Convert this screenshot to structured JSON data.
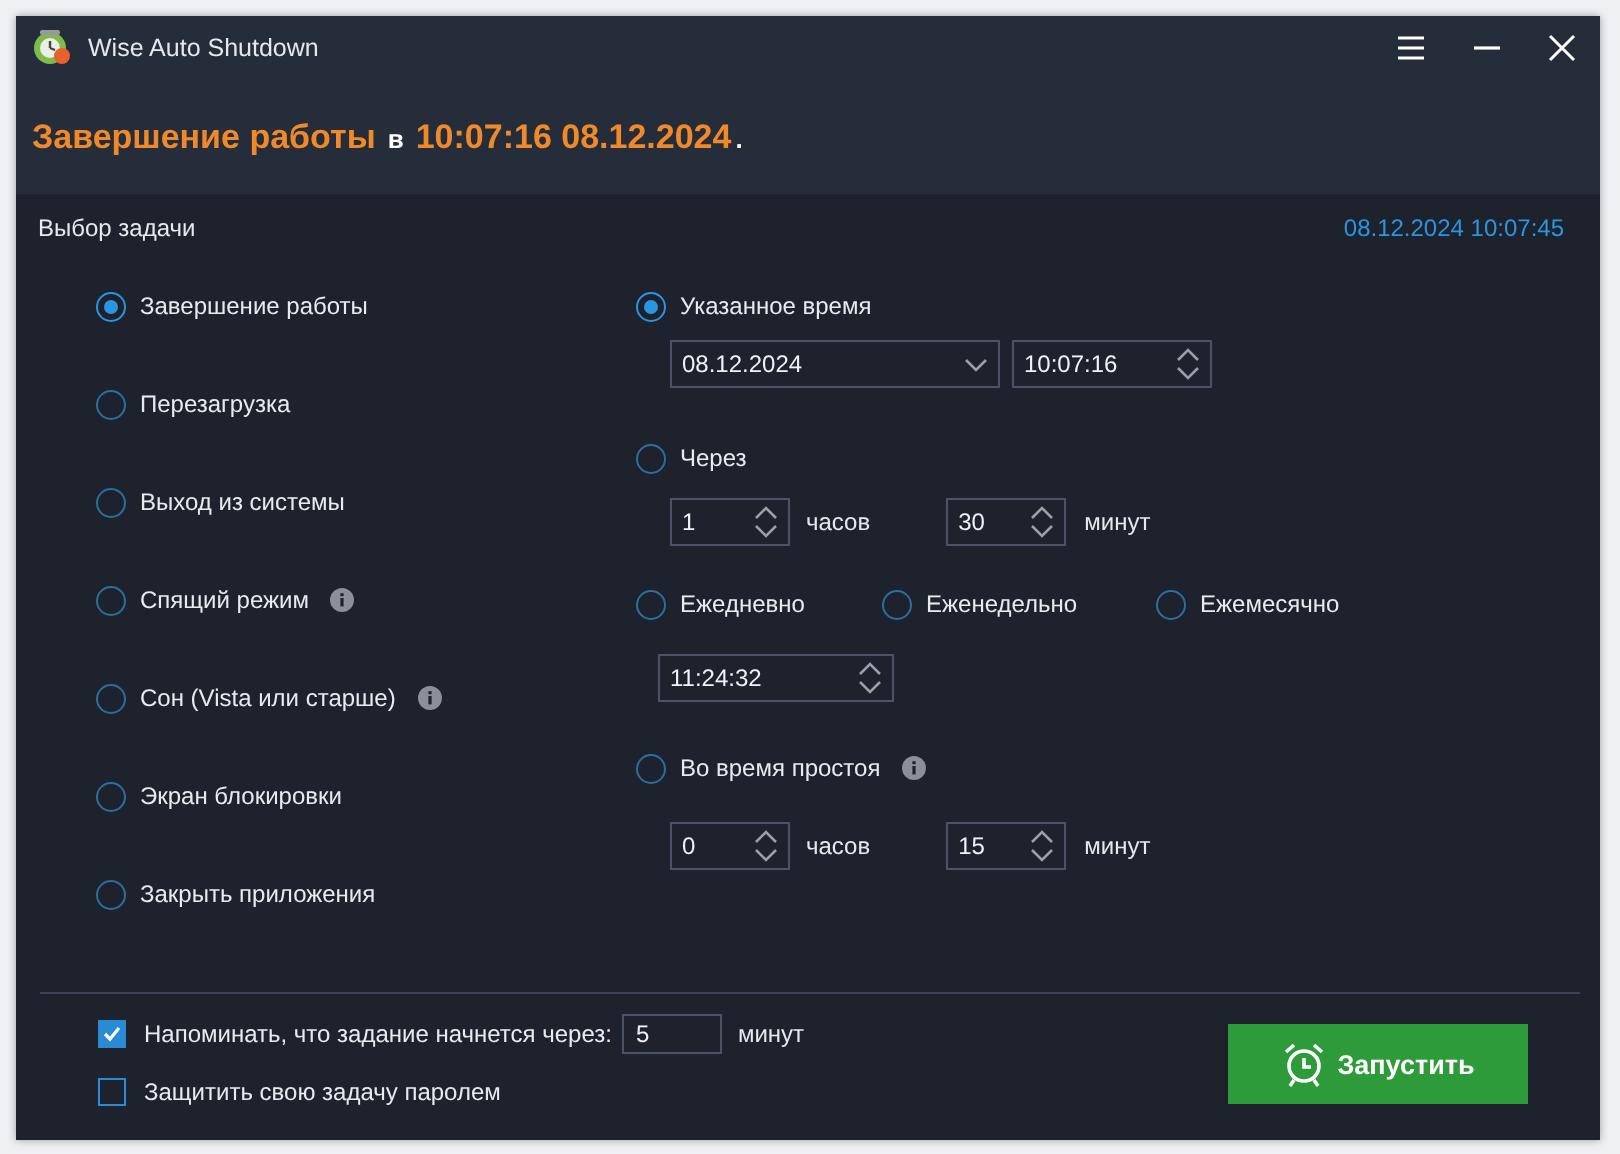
{
  "window": {
    "title": "Wise Auto Shutdown"
  },
  "heading": [
    {
      "text": "Завершение работы",
      "kind": "highlight"
    },
    {
      "text": "в",
      "kind": "plain"
    },
    {
      "text": "10:07:16 08.12.2024",
      "kind": "highlight"
    },
    {
      "text": ".",
      "kind": "plain"
    }
  ],
  "task_label": "Выбор задачи",
  "current_time": "08.12.2024 10:07:45",
  "tasks": [
    {
      "label": "Завершение работы",
      "selected": true,
      "info": false
    },
    {
      "label": "Перезагрузка",
      "selected": false,
      "info": false
    },
    {
      "label": "Выход из системы",
      "selected": false,
      "info": false
    },
    {
      "label": "Спящий режим",
      "selected": false,
      "info": true
    },
    {
      "label": "Сон (Vista или старше)",
      "selected": false,
      "info": true
    },
    {
      "label": "Экран блокировки",
      "selected": false,
      "info": false
    },
    {
      "label": "Закрыть приложения",
      "selected": false,
      "info": false
    }
  ],
  "specified": {
    "label": "Указанное время",
    "selected": true,
    "date": "08.12.2024",
    "time": "10:07:16"
  },
  "after": {
    "label": "Через",
    "selected": false,
    "hours": "1",
    "hours_unit": "часов",
    "minutes": "30",
    "minutes_unit": "минут"
  },
  "repeat": {
    "options": [
      {
        "label": "Ежедневно",
        "selected": false
      },
      {
        "label": "Еженедельно",
        "selected": false
      },
      {
        "label": "Ежемесячно",
        "selected": false
      }
    ],
    "time": "11:24:32"
  },
  "idle": {
    "label": "Во время простоя",
    "selected": false,
    "info": true,
    "hours": "0",
    "hours_unit": "часов",
    "minutes": "15",
    "minutes_unit": "минут"
  },
  "remind": {
    "label": "Напоминать, что задание начнется через:",
    "checked": true,
    "value": "5",
    "unit": "минут"
  },
  "protect": {
    "label": "Защитить свою задачу паролем",
    "checked": false
  },
  "start_button": "Запустить"
}
